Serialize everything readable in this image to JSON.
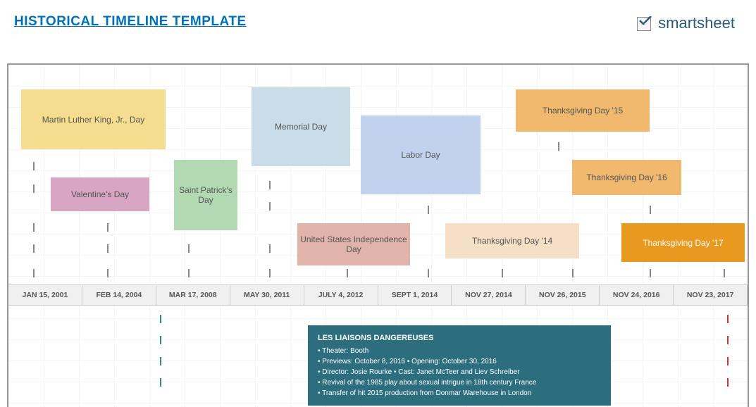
{
  "header": {
    "title": "HISTORICAL TIMELINE TEMPLATE",
    "logo_text": "smartsheet"
  },
  "dates": [
    "JAN 15, 2001",
    "FEB 14, 2004",
    "MAR 17, 2008",
    "MAY 30, 2011",
    "JULY 4, 2012",
    "SEPT 1, 2014",
    "NOV 27, 2014",
    "NOV 26, 2015",
    "NOV 24, 2016",
    "NOV 23, 2017"
  ],
  "events": {
    "mlk": "Martin Luther King, Jr., Day",
    "valentine": "Valentine's Day",
    "stpatrick": "Saint Patrick's Day",
    "memorial": "Memorial Day",
    "independence": "United States Independence Day",
    "labor": "Labor Day",
    "tg14": "Thanksgiving Day '14",
    "tg15": "Thanksgiving Day '15",
    "tg16": "Thanksgiving Day '16",
    "tg17": "Thanksgiving Day '17"
  },
  "info": {
    "title": "LES LIAISONS DANGEREUSES",
    "line1": "• Theater: Booth",
    "line2": "• Previews: October 8, 2016 • Opening: October 30, 2016",
    "line3": "• Director: Josie Rourke • Cast: Janet McTeer and Liev Schreiber",
    "line4": "• Revival of the 1985 play about sexual intrigue in 18th century France",
    "line5": "• Transfer of hit 2015 production from Donmar Warehouse in London"
  }
}
